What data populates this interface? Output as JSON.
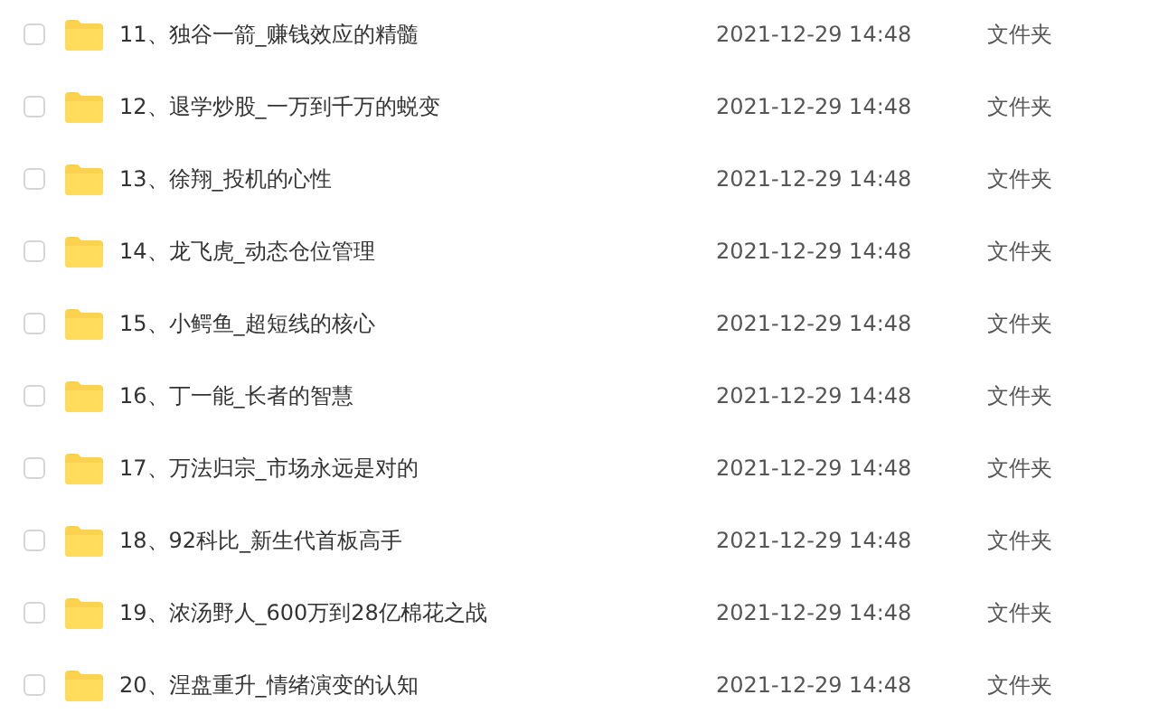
{
  "files": [
    {
      "name": "11、独谷一箭_赚钱效应的精髓",
      "modified": "2021-12-29 14:48",
      "type": "文件夹",
      "checked": false
    },
    {
      "name": "12、退学炒股_一万到千万的蜕变",
      "modified": "2021-12-29 14:48",
      "type": "文件夹",
      "checked": false
    },
    {
      "name": "13、徐翔_投机的心性",
      "modified": "2021-12-29 14:48",
      "type": "文件夹",
      "checked": false
    },
    {
      "name": "14、龙飞虎_动态仓位管理",
      "modified": "2021-12-29 14:48",
      "type": "文件夹",
      "checked": false
    },
    {
      "name": "15、小鳄鱼_超短线的核心",
      "modified": "2021-12-29 14:48",
      "type": "文件夹",
      "checked": false
    },
    {
      "name": "16、丁一能_长者的智慧",
      "modified": "2021-12-29 14:48",
      "type": "文件夹",
      "checked": false
    },
    {
      "name": "17、万法归宗_市场永远是对的",
      "modified": "2021-12-29 14:48",
      "type": "文件夹",
      "checked": false
    },
    {
      "name": "18、92科比_新生代首板高手",
      "modified": "2021-12-29 14:48",
      "type": "文件夹",
      "checked": false
    },
    {
      "name": "19、浓汤野人_600万到28亿棉花之战",
      "modified": "2021-12-29 14:48",
      "type": "文件夹",
      "checked": false
    },
    {
      "name": "20、涅盘重升_情绪演变的认知",
      "modified": "2021-12-29 14:48",
      "type": "文件夹",
      "checked": false
    }
  ]
}
